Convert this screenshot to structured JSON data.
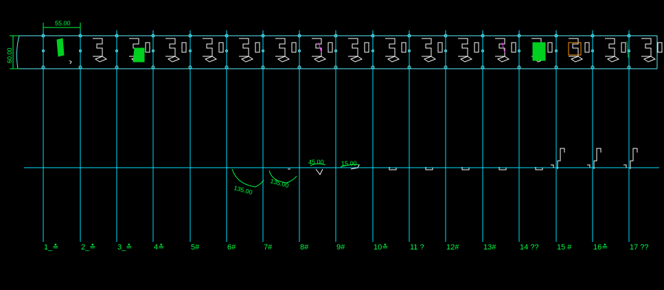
{
  "colors": {
    "background": "#000000",
    "grid": "#00e5ff",
    "strip": "#5ff2ff",
    "profile": "#ffffff",
    "dimension": "#00ff44",
    "hatch": "#00d020",
    "accent_magenta": "#ff33ff",
    "accent_orange": "#ff9900",
    "accent_yellow": "#ffff33"
  },
  "dimensions": {
    "top_width": "55.00",
    "strip_height": "60.00",
    "angle_a": "135.00",
    "angle_b": "135.00",
    "angle_c": "45.00",
    "angle_d": "15.00"
  },
  "stations": [
    {
      "label": "1_≛"
    },
    {
      "label": "2_≛"
    },
    {
      "label": "3_≛"
    },
    {
      "label": "4≛"
    },
    {
      "label": "5#"
    },
    {
      "label": "6#"
    },
    {
      "label": "7#"
    },
    {
      "label": "8#"
    },
    {
      "label": "9#"
    },
    {
      "label": "10≛"
    },
    {
      "label": "11 ?"
    },
    {
      "label": "12#"
    },
    {
      "label": "13#"
    },
    {
      "label": "14 ??"
    },
    {
      "label": "15 #"
    },
    {
      "label": "16≛"
    },
    {
      "label": "17 ??"
    }
  ]
}
